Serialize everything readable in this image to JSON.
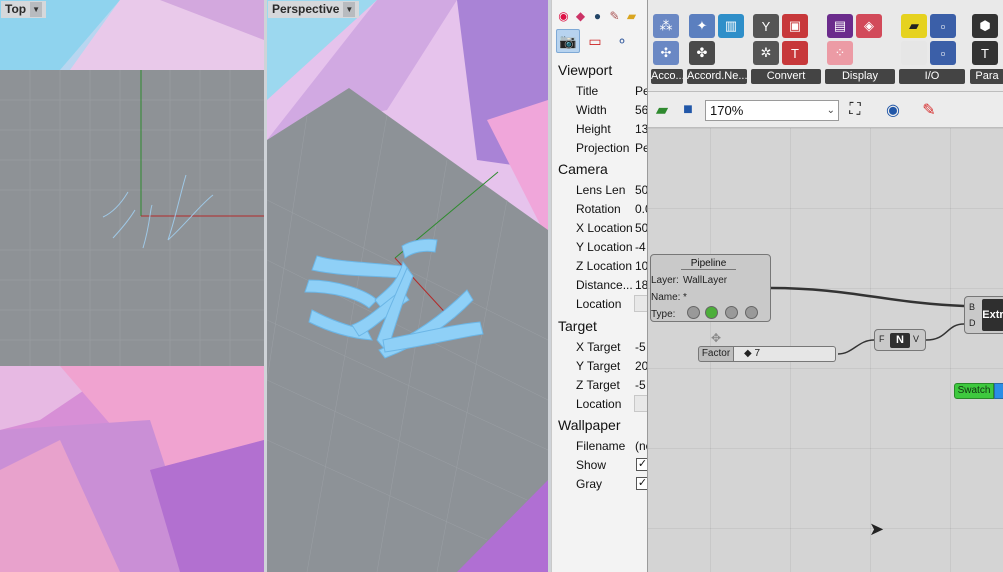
{
  "viewports": {
    "top": {
      "label": "Top",
      "dropdown_icon": "caret-down-icon"
    },
    "perspective": {
      "label": "Perspective",
      "dropdown_icon": "caret-down-icon"
    }
  },
  "properties": {
    "sections": {
      "viewport": "Viewport",
      "camera": "Camera",
      "target": "Target",
      "wallpaper": "Wallpaper"
    },
    "viewport_rows": [
      {
        "label": "Title",
        "value": "Pe"
      },
      {
        "label": "Width",
        "value": "56"
      },
      {
        "label": "Height",
        "value": "13"
      },
      {
        "label": "Projection",
        "value": "Pe"
      }
    ],
    "camera_rows": [
      {
        "label": "Lens Len",
        "value": "50"
      },
      {
        "label": "Rotation",
        "value": "0.0"
      },
      {
        "label": "X Location",
        "value": "50"
      },
      {
        "label": "Y Location",
        "value": "-4"
      },
      {
        "label": "Z Location",
        "value": "10"
      },
      {
        "label": "Distance...",
        "value": "18"
      },
      {
        "label": "Location",
        "value": ""
      }
    ],
    "target_rows": [
      {
        "label": "X Target",
        "value": "-5"
      },
      {
        "label": "Y Target",
        "value": "20"
      },
      {
        "label": "Z Target",
        "value": "-5"
      },
      {
        "label": "Location",
        "value": ""
      }
    ],
    "wallpaper_rows": [
      {
        "label": "Filename",
        "value": "(nc"
      },
      {
        "label": "Show",
        "checked": true
      },
      {
        "label": "Gray",
        "checked": true
      }
    ]
  },
  "grasshopper": {
    "ribbon_groups": [
      {
        "label": "Acco..."
      },
      {
        "label": "Accord.Ne..."
      },
      {
        "label": "Convert"
      },
      {
        "label": "Display"
      },
      {
        "label": "I/O"
      },
      {
        "label": "Para"
      }
    ],
    "zoom": "170%",
    "nodes": {
      "pipeline": {
        "title": "Pipeline",
        "layer_label": "Layer:",
        "layer_value": "WallLayer",
        "name_label": "Name:",
        "name_value": "*",
        "type_label": "Type:"
      },
      "factor": {
        "label": "Factor",
        "value": "◆ 7"
      },
      "unit": {
        "in": "F",
        "core": "N",
        "out": "V"
      },
      "extrude": {
        "in_b": "B",
        "in_d": "D",
        "core": "Extr"
      },
      "swatch": {
        "label": "Swatch"
      }
    }
  }
}
